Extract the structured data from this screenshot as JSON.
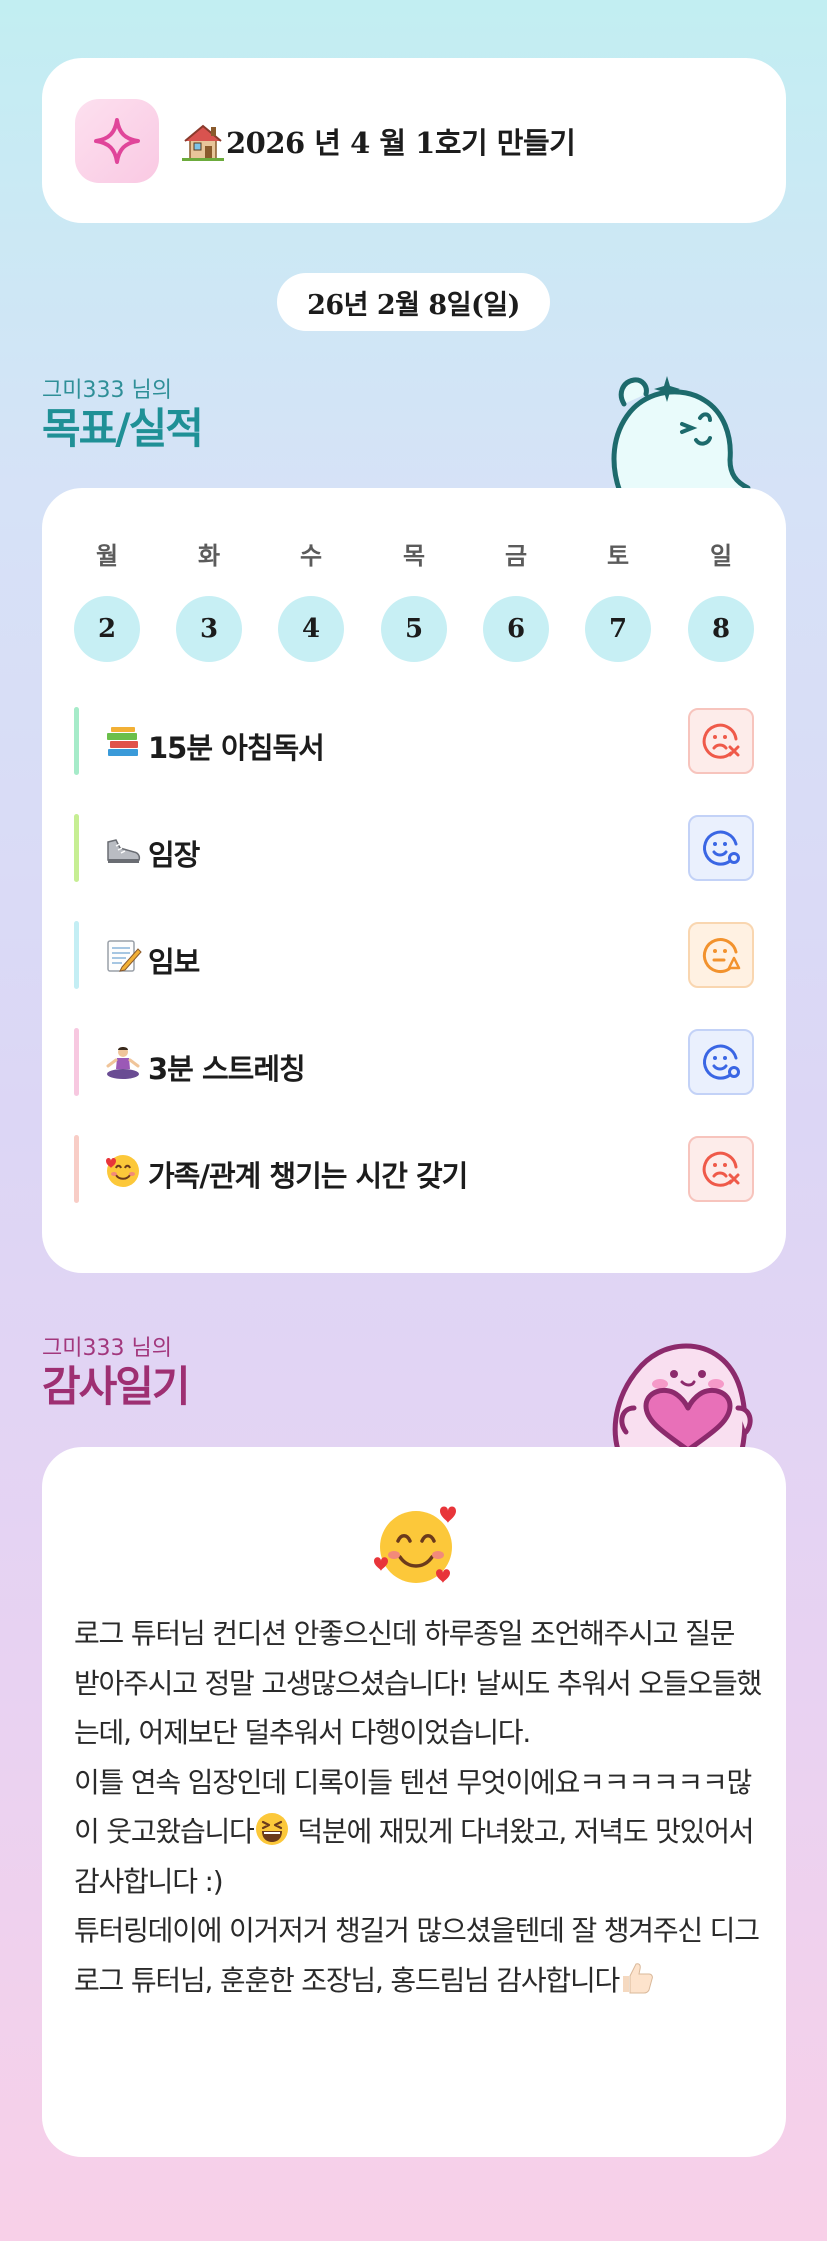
{
  "cohort": {
    "title": "2026 년 4 월 1호기 만들기",
    "sparkle_icon": "sparkle-icon",
    "house_icon": "house-icon"
  },
  "date": "26년 2월 8일(일)",
  "goals_section": {
    "owner": "그미333 님의",
    "title": "목표/실적"
  },
  "week": {
    "days": [
      "월",
      "화",
      "수",
      "목",
      "금",
      "토",
      "일"
    ],
    "dates": [
      "2",
      "3",
      "4",
      "5",
      "6",
      "7",
      "8"
    ]
  },
  "goals": [
    {
      "emoji": "books-emoji",
      "label": "15분 아침독서",
      "bar_color": "#a6ebc9",
      "status": "fail",
      "status_icon": "sad-face-x-icon"
    },
    {
      "emoji": "sneaker-emoji",
      "label": " 임장",
      "bar_color": "#c6ee93",
      "status": "done",
      "status_icon": "smile-face-check-icon"
    },
    {
      "emoji": "memo-emoji",
      "label": "임보",
      "bar_color": "#c4eef4",
      "status": "warning",
      "status_icon": "neutral-face-warning-icon"
    },
    {
      "emoji": "yoga-emoji",
      "label": "3분 스트레칭",
      "bar_color": "#f7c8e0",
      "status": "done",
      "status_icon": "smile-face-check-icon"
    },
    {
      "emoji": "smiling-hearts-emoji",
      "label": " 가족/관계 챙기는 시간 갖기",
      "bar_color": "#f8cdc6",
      "status": "fail",
      "status_icon": "sad-face-x-icon"
    }
  ],
  "status_colors": {
    "fail": {
      "fg": "#ef5a4a",
      "bg": "#fdecea",
      "border": "#f7c4bd"
    },
    "done": {
      "fg": "#3a66e4",
      "bg": "#eaf0fd",
      "border": "#c3d2f7"
    },
    "warning": {
      "fg": "#f2922d",
      "bg": "#fff1e2",
      "border": "#f9d6b0"
    }
  },
  "gratitude_section": {
    "owner": "그미333 님의",
    "title": "감사일기"
  },
  "gratitude": {
    "emoji": "smiling-face-with-hearts-emoji",
    "paragraphs": [
      "로그 튜터님 컨디션 안좋으신데 하루종일 조언해주시고 질문 받아주시고 정말 고생많으셨습니다! 날씨도 추워서 오들오들했는데, 어제보단 덜추워서 다행이었습니다.",
      "이틀 연속 임장인데 디록이들 텐션 무엇이에요ㅋㅋㅋㅋㅋㅋ많이 웃고왔습니다",
      " 덕분에 재밌게 다녀왔고, 저녁도 맛있어서 감사합니다 :)",
      "튜터링데이에 이거저거 챙길거 많으셨을텐데 잘 챙겨주신 디그로그 튜터님, 훈훈한 조장님, 홍드림님 감사합니다"
    ],
    "inline_emojis": [
      "grinning-squint-emoji",
      "thumbs-up-emoji"
    ]
  }
}
